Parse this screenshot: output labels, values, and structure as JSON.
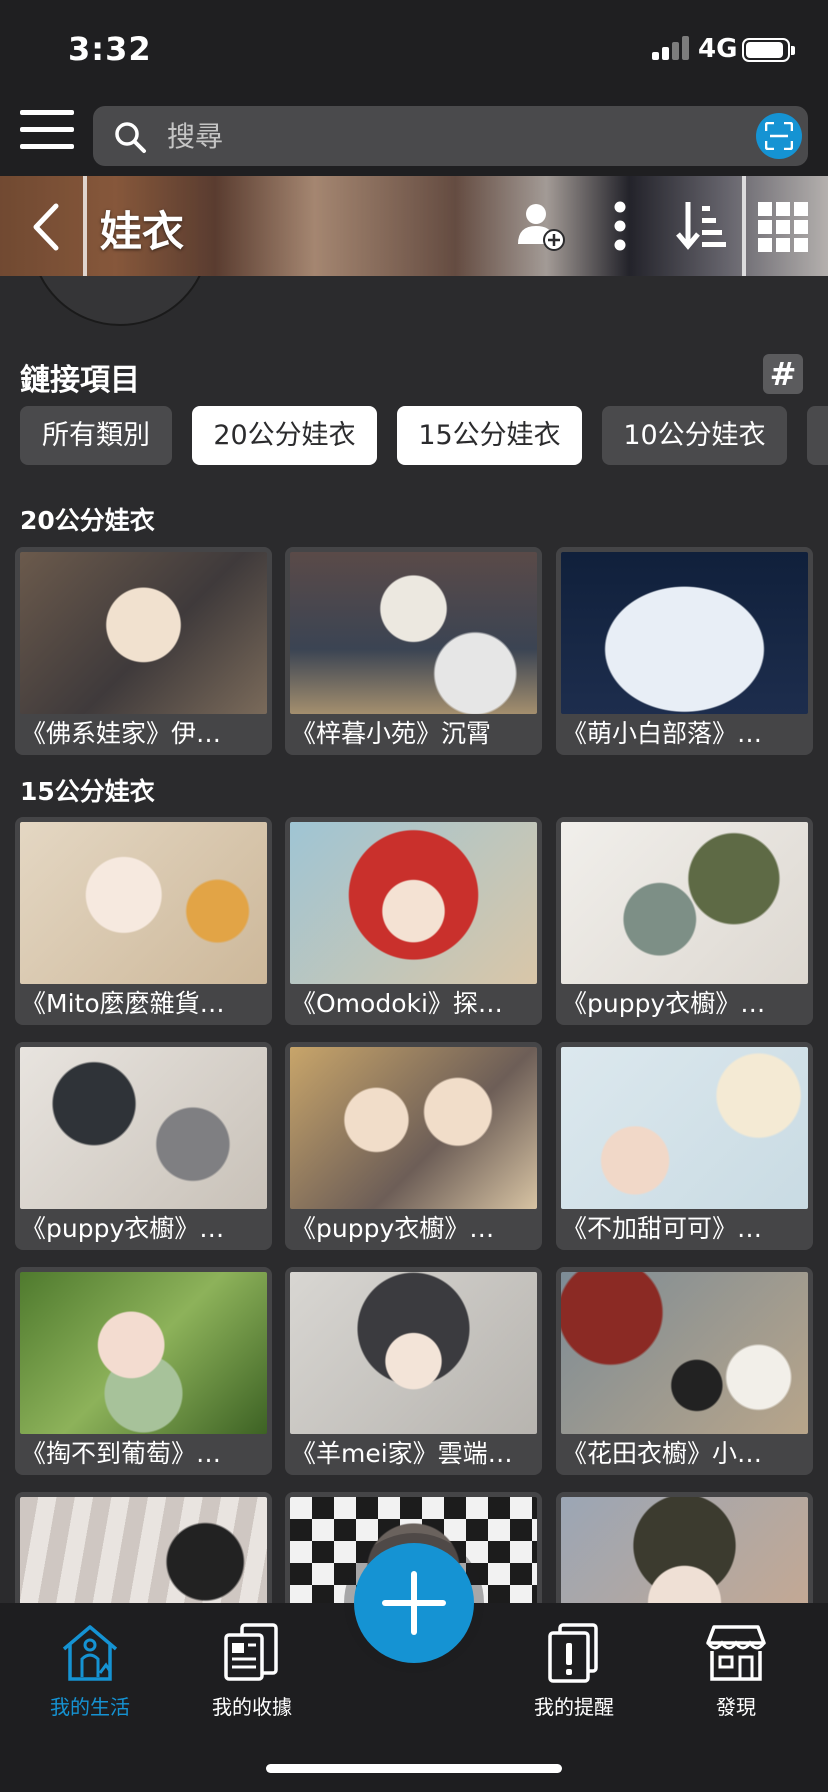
{
  "status_bar": {
    "time": "3:32",
    "network": "4G",
    "battery_level": 0.92
  },
  "search": {
    "placeholder": "搜尋",
    "value": ""
  },
  "header": {
    "title": "娃衣"
  },
  "linked_items": {
    "title": "鏈接項目",
    "hashtag_symbol": "#",
    "chips": [
      {
        "label": "所有類別",
        "selected": false
      },
      {
        "label": "20公分娃衣",
        "selected": true
      },
      {
        "label": "15公分娃衣",
        "selected": true
      },
      {
        "label": "10公分娃衣",
        "selected": false
      },
      {
        "label": "",
        "selected": false
      }
    ]
  },
  "groups": [
    {
      "title": "20公分娃衣",
      "items": [
        {
          "label": "《佛系娃家》伊…"
        },
        {
          "label": "《梓暮小苑》沉霄"
        },
        {
          "label": "《萌小白部落》…"
        }
      ]
    },
    {
      "title": "15公分娃衣",
      "items": [
        {
          "label": "《Mito麼麼雜貨…"
        },
        {
          "label": "《Omodoki》探…"
        },
        {
          "label": "《puppy衣櫥》…"
        },
        {
          "label": "《puppy衣櫥》…"
        },
        {
          "label": "《puppy衣櫥》…"
        },
        {
          "label": "《不加甜可可》…"
        },
        {
          "label": "《掏不到葡萄》…"
        },
        {
          "label": "《羊mei家》雲端…"
        },
        {
          "label": "《花田衣櫥》小…"
        },
        {
          "label": ""
        },
        {
          "label": ""
        },
        {
          "label": ""
        }
      ]
    }
  ],
  "bottom_nav": {
    "items": [
      {
        "label": "我的生活",
        "icon": "home-person-icon",
        "active": true
      },
      {
        "label": "我的收據",
        "icon": "receipt-icon",
        "active": false
      },
      {
        "label": "我的提醒",
        "icon": "reminder-icon",
        "active": false
      },
      {
        "label": "發現",
        "icon": "store-icon",
        "active": false
      }
    ],
    "fab_icon": "plus-icon"
  },
  "colors": {
    "accent": "#1593d3",
    "background": "#2b2b2d",
    "card": "#454547",
    "chip_dark": "#4a4a4c"
  }
}
